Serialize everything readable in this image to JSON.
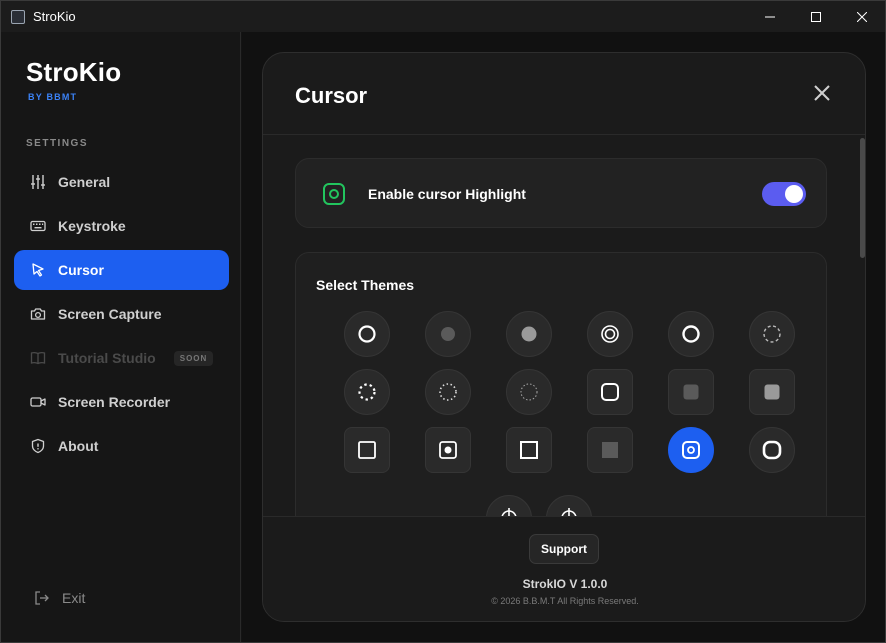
{
  "window": {
    "title": "StroKio"
  },
  "sidebar": {
    "brand": "StroKio",
    "brand_sub": "BY BBMT",
    "section_label": "SETTINGS",
    "items": [
      {
        "label": "General",
        "icon": "sliders-icon",
        "active": false,
        "disabled": false
      },
      {
        "label": "Keystroke",
        "icon": "keyboard-icon",
        "active": false,
        "disabled": false
      },
      {
        "label": "Cursor",
        "icon": "cursor-arrow-icon",
        "active": true,
        "disabled": false
      },
      {
        "label": "Screen Capture",
        "icon": "camera-icon",
        "active": false,
        "disabled": false
      },
      {
        "label": "Tutorial Studio",
        "icon": "book-icon",
        "active": false,
        "disabled": true,
        "badge": "SOON"
      },
      {
        "label": "Screen Recorder",
        "icon": "video-icon",
        "active": false,
        "disabled": false
      },
      {
        "label": "About",
        "icon": "shield-icon",
        "active": false,
        "disabled": false
      }
    ],
    "exit_label": "Exit"
  },
  "panel": {
    "title": "Cursor",
    "highlight": {
      "label": "Enable cursor Highlight",
      "enabled": true
    },
    "themes": {
      "title": "Select Themes",
      "selected_index": 16,
      "count": 20
    }
  },
  "footer": {
    "support_label": "Support",
    "version": "StrokIO V 1.0.0",
    "copyright": "© 2026 B.B.M.T All Rights Reserved."
  },
  "colors": {
    "accent": "#1d5ff0",
    "toggle": "#5b5cf0",
    "highlight_icon": "#22c55e",
    "brand_sub": "#3b82f6"
  }
}
